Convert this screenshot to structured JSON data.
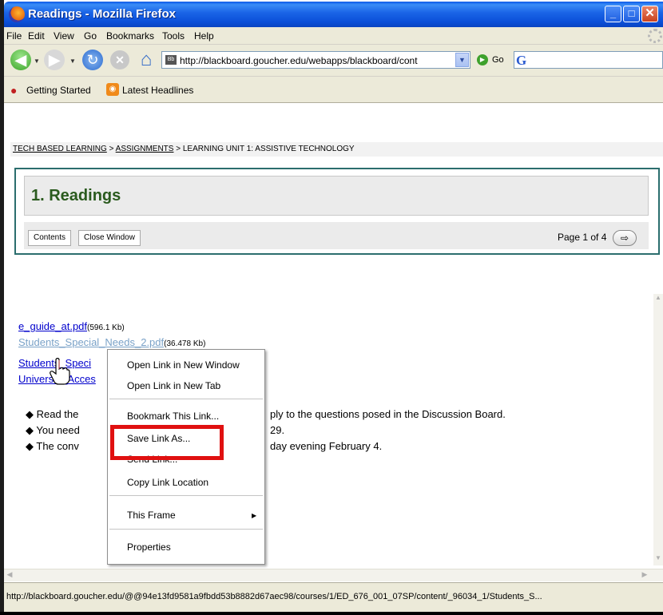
{
  "window": {
    "title": "Readings - Mozilla Firefox"
  },
  "menubar": {
    "items": [
      "File",
      "Edit",
      "View",
      "Go",
      "Bookmarks",
      "Tools",
      "Help"
    ]
  },
  "navbar": {
    "url": "http://blackboard.goucher.edu/webapps/blackboard/cont",
    "go_label": "Go",
    "search_logo": "G"
  },
  "bookmarks": {
    "items": [
      "Getting Started",
      "Latest Headlines"
    ]
  },
  "breadcrumb": {
    "items": [
      "TECH BASED LEARNING",
      "ASSIGNMENTS",
      "LEARNING UNIT 1: ASSISTIVE TECHNOLOGY"
    ],
    "separator": ">"
  },
  "panel": {
    "title": "1. Readings",
    "contents_label": "Contents",
    "close_label": "Close Window",
    "page_info": "Page 1 of 4"
  },
  "files": [
    {
      "name": "e_guide_at.pdf",
      "size": "(596.1 Kb)"
    },
    {
      "name": "Students_Special_Needs_2.pdf",
      "size": "(36.478 Kb)"
    },
    {
      "name": "Students_Speci",
      "size": ""
    },
    {
      "name": "Universal_Acces",
      "size": ""
    }
  ],
  "bullets": [
    {
      "left": "Read the",
      "right": "ply to the questions posed in the Discussion Board."
    },
    {
      "left": "You need",
      "right": "29."
    },
    {
      "left": "The conv",
      "right": "day evening February 4."
    }
  ],
  "context_menu": {
    "items": [
      "Open Link in New Window",
      "Open Link in New Tab",
      "Bookmark This Link...",
      "Save Link As...",
      "Send Link...",
      "Copy Link Location",
      "This Frame",
      "Properties"
    ]
  },
  "statusbar": {
    "text": "http://blackboard.goucher.edu/@@94e13fd9581a9fbdd53b8882d67aec98/courses/1/ED_676_001_07SP/content/_96034_1/Students_S..."
  },
  "colors": {
    "highlight": "#e01010",
    "panel_border": "#2b6e6e",
    "title_green": "#2a5a1e"
  }
}
